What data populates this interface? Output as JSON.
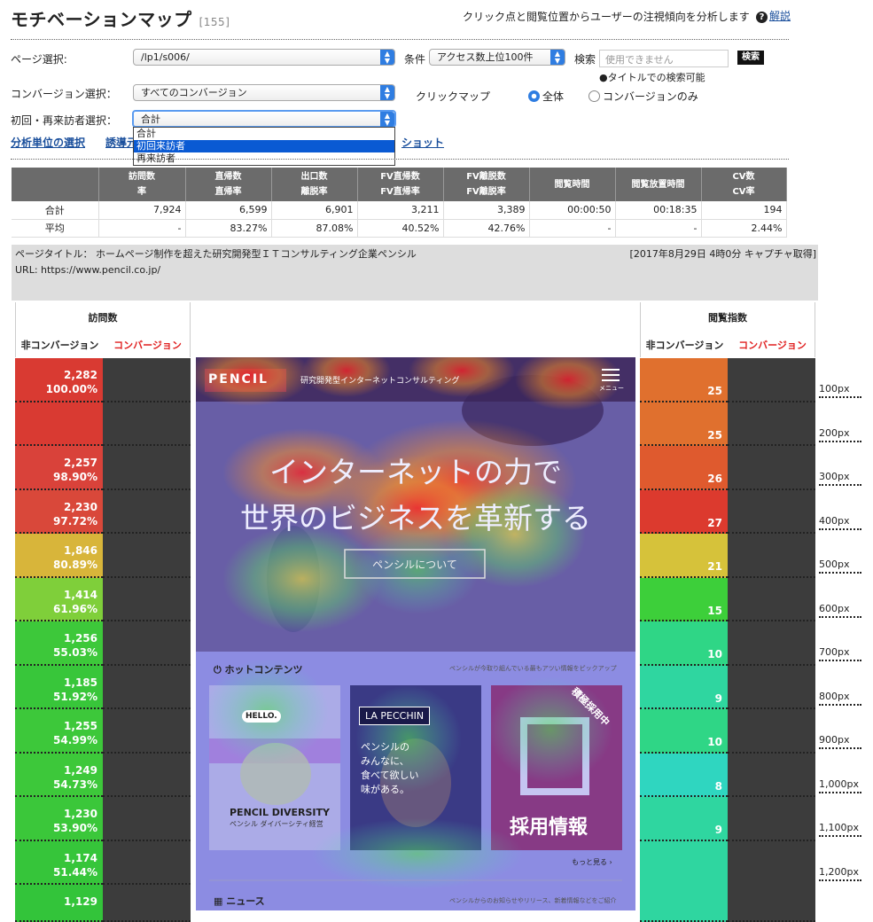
{
  "header": {
    "title": "モチベーションマップ",
    "count": "[155]",
    "subtitle": "クリック点と閲覧位置からユーザーの注視傾向を分析します",
    "help_label": "解説"
  },
  "filters": {
    "page_label": "ページ選択:",
    "page_value": "/lp1/s006/",
    "condition_label": "条件",
    "condition_value": "アクセス数上位100件",
    "search_label": "検索",
    "search_placeholder": "使用できません",
    "search_button": "検索",
    "search_note": "●タイトルでの検索可能",
    "conversion_label": "コンバージョン選択：",
    "conversion_value": "すべてのコンバージョン",
    "clickmap_label": "クリックマップ",
    "radio_all": "全体",
    "radio_conv_only": "コンバージョンのみ",
    "visitor_label": "初回・再来訪者選択：",
    "visitor_value": "合計",
    "visitor_options": [
      "合計",
      "初回来訪者",
      "再来訪者"
    ],
    "link_unit": "分析単位の選択",
    "link_partial": "誘導元",
    "link_shot": "ショット"
  },
  "stats": {
    "headers": [
      [
        "",
        ""
      ],
      [
        "訪問数",
        "率"
      ],
      [
        "直帰数",
        "直帰率"
      ],
      [
        "出口数",
        "離脱率"
      ],
      [
        "FV直帰数",
        "FV直帰率"
      ],
      [
        "FV離脱数",
        "FV離脱率"
      ],
      [
        "閲覧時間",
        ""
      ],
      [
        "閲覧放置時間",
        ""
      ],
      [
        "CV数",
        "CV率"
      ]
    ],
    "rows": [
      [
        "合計",
        "7,924",
        "6,599",
        "6,901",
        "3,211",
        "3,389",
        "00:00:50",
        "00:18:35",
        "194"
      ],
      [
        "平均",
        "-",
        "83.27%",
        "87.08%",
        "40.52%",
        "42.76%",
        "-",
        "-",
        "2.44%"
      ]
    ]
  },
  "page_info": {
    "title_line": "ページタイトル： ホームページ制作を超えた研究開発型ＩＴコンサルティング企業ペンシル",
    "url_line": "URL: https://www.pencil.co.jp/",
    "capture": "[2017年8月29日 4時0分 キャプチャ取得]"
  },
  "visits": {
    "group_label": "訪問数",
    "col_nonconv": "非コンバージョン",
    "col_conv": "コンバージョン",
    "rows": [
      {
        "count": "2,282",
        "pct": "100.00%",
        "color": "#d93a32"
      },
      {
        "count": "",
        "pct": "",
        "color": "#d93a32"
      },
      {
        "count": "2,257",
        "pct": "98.90%",
        "color": "#d9423a"
      },
      {
        "count": "2,230",
        "pct": "97.72%",
        "color": "#d9483a"
      },
      {
        "count": "1,846",
        "pct": "80.89%",
        "color": "#d8b53a"
      },
      {
        "count": "1,414",
        "pct": "61.96%",
        "color": "#7fcf3a"
      },
      {
        "count": "1,256",
        "pct": "55.03%",
        "color": "#3dc83a"
      },
      {
        "count": "1,185",
        "pct": "51.92%",
        "color": "#38c63a"
      },
      {
        "count": "1,255",
        "pct": "54.99%",
        "color": "#3dc83a"
      },
      {
        "count": "1,249",
        "pct": "54.73%",
        "color": "#3dc83a"
      },
      {
        "count": "1,230",
        "pct": "53.90%",
        "color": "#3bc73a"
      },
      {
        "count": "1,174",
        "pct": "51.44%",
        "color": "#36c53a"
      },
      {
        "count": "1,129",
        "pct": "",
        "color": "#33c43a"
      }
    ]
  },
  "browse": {
    "group_label": "閲覧指数",
    "col_nonconv": "非コンバージョン",
    "col_conv": "コンバージョン",
    "rows": [
      {
        "value": "25",
        "color": "#e0702e"
      },
      {
        "value": "25",
        "color": "#e0702e"
      },
      {
        "value": "26",
        "color": "#df5a2e"
      },
      {
        "value": "27",
        "color": "#dc3a2e"
      },
      {
        "value": "21",
        "color": "#d6c23a"
      },
      {
        "value": "15",
        "color": "#3dcf3a"
      },
      {
        "value": "10",
        "color": "#2fd686"
      },
      {
        "value": "9",
        "color": "#2fd6a0"
      },
      {
        "value": "10",
        "color": "#2fd686"
      },
      {
        "value": "8",
        "color": "#2fd6c0"
      },
      {
        "value": "9",
        "color": "#2fd6a0"
      },
      {
        "value": "",
        "color": "#2fd6a0"
      }
    ]
  },
  "px_labels": [
    "100px",
    "200px",
    "300px",
    "400px",
    "500px",
    "600px",
    "700px",
    "800px",
    "900px",
    "1,000px",
    "1,100px",
    "1,200px"
  ],
  "screenshot": {
    "logo": "PENCIL",
    "tagline": "研究開発型インターネットコンサルティング",
    "menu": "メニュー",
    "hero_line1": "インターネットの力で",
    "hero_line2": "世界のビジネスを革新する",
    "hero_button": "ペンシルについて",
    "hot_title": "ホットコンテンツ",
    "hot_desc": "ペンシルが今取り組んでいる最もアツい情報をピックアップ",
    "card1_hello": "HELLO.",
    "card1_title": "PENCIL DIVERSITY",
    "card1_sub": "ペンシル ダイバーシティ経営",
    "card2_brand": "LA PECCHIN",
    "card2_text": "ペンシルの\nみんなに、\n食べて欲しい\n味がある。",
    "card3_badge": "積極採用中",
    "card3_title": "採用情報",
    "more": "もっと見る ›",
    "news_title": "ニュース",
    "news_desc": "ペンシルからのお知らせやリリース、新着情報などをご紹介"
  }
}
